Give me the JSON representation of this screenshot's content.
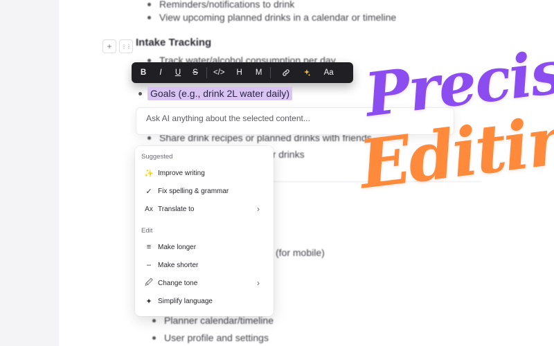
{
  "document": {
    "top_items": [
      "Reminders/notifications to drink",
      "View upcoming planned drinks in a calendar or timeline"
    ],
    "heading": "Intake Tracking",
    "intake_items": [
      "Track water/alcohol consumption per day",
      "Goals (e.g., drink 2L water daily)",
      "Share drink recipes or planned drinks with friends",
      "for drinks"
    ],
    "fragment_mobile": "(for mobile)",
    "bottom_items": [
      "Planner calendar/timeline",
      "User profile and settings"
    ]
  },
  "block_controls": {
    "add": "+",
    "drag": "⋮⋮"
  },
  "toolbar": {
    "bold": "B",
    "italic": "I",
    "underline": "U",
    "strike": "S",
    "code": "</>",
    "heading": "H",
    "mention": "M",
    "link_icon": "link-icon",
    "ai_icon": "sparkle-icon",
    "font": "Aa"
  },
  "ai_prompt": {
    "placeholder": "Ask AI anything about the selected content..."
  },
  "menu": {
    "suggested_label": "Suggested",
    "suggested": [
      {
        "icon": "✨",
        "label": "Improve writing"
      },
      {
        "icon": "✓",
        "label": "Fix spelling & grammar"
      },
      {
        "icon": "Ax",
        "label": "Translate to",
        "submenu": true
      }
    ],
    "edit_label": "Edit",
    "edit": [
      {
        "icon": "≡",
        "label": "Make longer"
      },
      {
        "icon": "–",
        "label": "Make shorter"
      },
      {
        "icon": "🖉",
        "label": "Change tone",
        "submenu": true
      },
      {
        "icon": "✦",
        "label": "Simplify language"
      }
    ],
    "chevron": "›"
  },
  "promo": {
    "line1": "Precise",
    "line2": "Editings"
  },
  "colors": {
    "highlight": "#d9c4f4",
    "toolbar_bg": "#1f1f24",
    "promo_purple": "#8b4cf0",
    "promo_orange": "#ff8a3c"
  }
}
